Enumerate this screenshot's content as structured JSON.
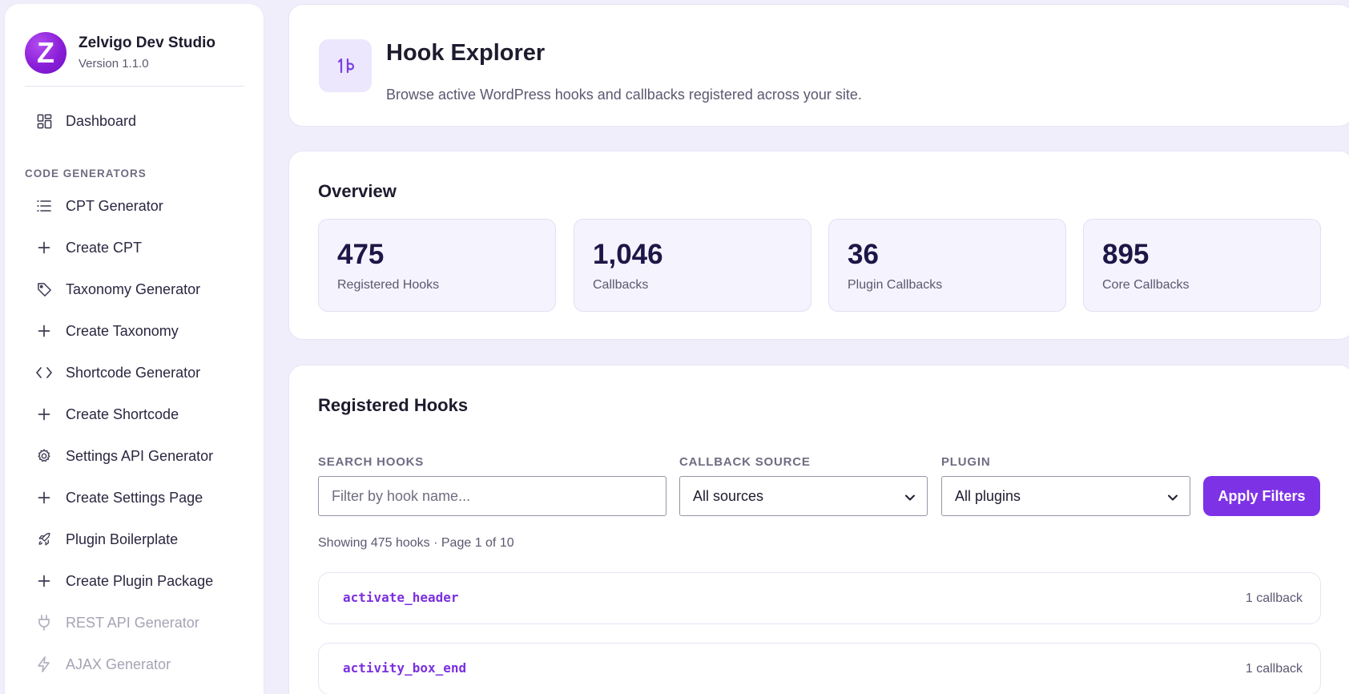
{
  "brand": {
    "name": "Zelvigo Dev Studio",
    "version": "Version 1.1.0",
    "logo_letter": "Z"
  },
  "sidebar": {
    "dashboard": {
      "label": "Dashboard",
      "icon": "dashboard-grid-icon"
    },
    "section_label": "CODE GENERATORS",
    "items": [
      {
        "label": "CPT Generator",
        "icon": "list-icon",
        "disabled": false
      },
      {
        "label": "Create CPT",
        "icon": "plus-icon",
        "disabled": false
      },
      {
        "label": "Taxonomy Generator",
        "icon": "tag-icon",
        "disabled": false
      },
      {
        "label": "Create Taxonomy",
        "icon": "plus-icon",
        "disabled": false
      },
      {
        "label": "Shortcode Generator",
        "icon": "code-icon",
        "disabled": false
      },
      {
        "label": "Create Shortcode",
        "icon": "plus-icon",
        "disabled": false
      },
      {
        "label": "Settings API Generator",
        "icon": "gear-icon",
        "disabled": false
      },
      {
        "label": "Create Settings Page",
        "icon": "plus-icon",
        "disabled": false
      },
      {
        "label": "Plugin Boilerplate",
        "icon": "rocket-icon",
        "disabled": false
      },
      {
        "label": "Create Plugin Package",
        "icon": "plus-icon",
        "disabled": false
      },
      {
        "label": "REST API Generator",
        "icon": "plug-icon",
        "disabled": true
      },
      {
        "label": "AJAX Generator",
        "icon": "bolt-icon",
        "disabled": true
      }
    ]
  },
  "header": {
    "icon": "hook-icon",
    "title": "Hook Explorer",
    "subtitle": "Browse active WordPress hooks and callbacks registered across your site."
  },
  "overview": {
    "title": "Overview",
    "stats": [
      {
        "value": "475",
        "label": "Registered Hooks"
      },
      {
        "value": "1,046",
        "label": "Callbacks"
      },
      {
        "value": "36",
        "label": "Plugin Callbacks"
      },
      {
        "value": "895",
        "label": "Core Callbacks"
      }
    ]
  },
  "hooks": {
    "title": "Registered Hooks",
    "search": {
      "label": "SEARCH HOOKS",
      "placeholder": "Filter by hook name...",
      "value": ""
    },
    "source": {
      "label": "CALLBACK SOURCE",
      "value": "All sources"
    },
    "plugin": {
      "label": "PLUGIN",
      "value": "All plugins"
    },
    "apply_label": "Apply Filters",
    "showing": "Showing 475 hooks · Page 1 of 10",
    "rows": [
      {
        "name": "activate_header",
        "count": "1 callback"
      },
      {
        "name": "activity_box_end",
        "count": "1 callback"
      }
    ]
  },
  "colors": {
    "accent": "#7e32e6",
    "background": "#f1eefb",
    "stat_value": "#1d1747"
  }
}
